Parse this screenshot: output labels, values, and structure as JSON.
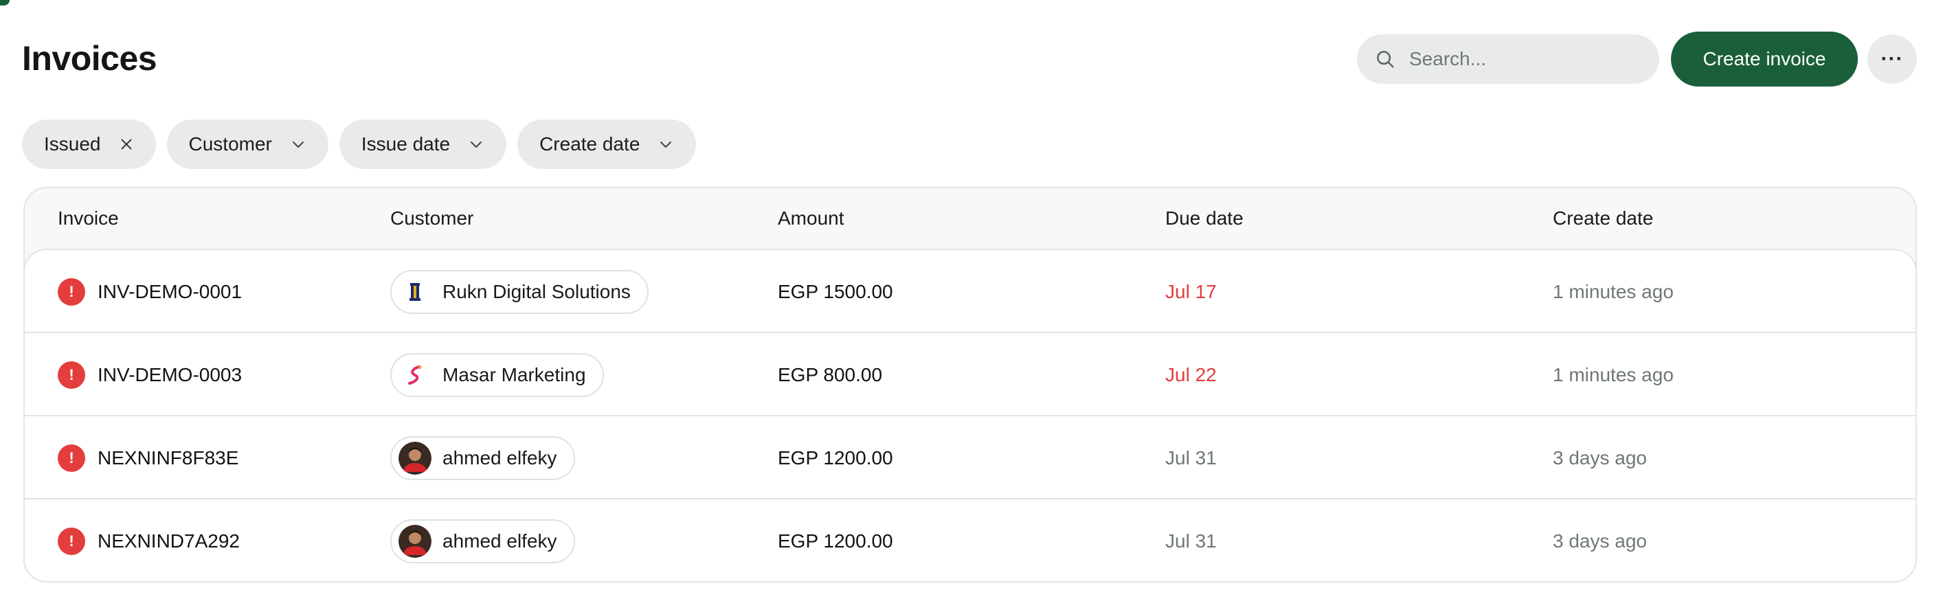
{
  "header": {
    "title": "Invoices",
    "search_placeholder": "Search...",
    "create_label": "Create invoice",
    "more_label": "···"
  },
  "filters": [
    {
      "label": "Issued",
      "icon": "close-icon"
    },
    {
      "label": "Customer",
      "icon": "chevron-down-icon"
    },
    {
      "label": "Issue date",
      "icon": "chevron-down-icon"
    },
    {
      "label": "Create date",
      "icon": "chevron-down-icon"
    }
  ],
  "table": {
    "columns": [
      "Invoice",
      "Customer",
      "Amount",
      "Due date",
      "Create date"
    ],
    "rows": [
      {
        "status_icon": "!",
        "invoice": "INV-DEMO-0001",
        "customer": "Rukn Digital Solutions",
        "customer_logo": "rukn-logo-icon",
        "amount": "EGP 1500.00",
        "due": "Jul 17",
        "due_status": "overdue",
        "created": "1 minutes ago"
      },
      {
        "status_icon": "!",
        "invoice": "INV-DEMO-0003",
        "customer": "Masar Marketing",
        "customer_logo": "masar-logo-icon",
        "amount": "EGP 800.00",
        "due": "Jul 22",
        "due_status": "overdue",
        "created": "1 minutes ago"
      },
      {
        "status_icon": "!",
        "invoice": "NEXNINF8F83E",
        "customer": "ahmed elfeky",
        "customer_logo": "avatar",
        "amount": "EGP 1200.00",
        "due": "Jul 31",
        "due_status": "normal",
        "created": "3 days ago"
      },
      {
        "status_icon": "!",
        "invoice": "NEXNIND7A292",
        "customer": "ahmed elfeky",
        "customer_logo": "avatar",
        "amount": "EGP 1200.00",
        "due": "Jul 31",
        "due_status": "normal",
        "created": "3 days ago"
      }
    ]
  },
  "colors": {
    "brand": "#1a5f3a",
    "overdue": "#e23d3d",
    "alert": "#e43d3d",
    "muted_text": "#6f7873",
    "chip_bg": "#e9ebea"
  }
}
